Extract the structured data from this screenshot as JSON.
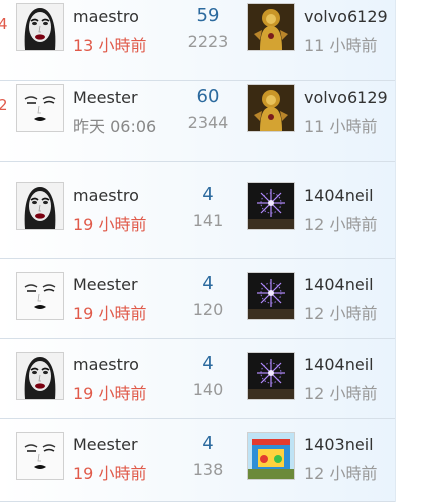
{
  "rows": [
    {
      "left_mark": "4",
      "author": "maestro",
      "author_time": "13 小時前",
      "author_time_color": "#e05a4a",
      "replies": "59",
      "views": "2223",
      "last_user": "volvo6129",
      "last_time": "11 小時前",
      "avatar_icon": "woman-face-icon",
      "thumb_icon": "golden-buddha-icon"
    },
    {
      "left_mark": "2",
      "author": "Meester",
      "author_time": "昨天 06:06",
      "author_time_color": "#888888",
      "replies": "60",
      "views": "2344",
      "last_user": "volvo6129",
      "last_time": "11 小時前",
      "avatar_icon": "sketch-face-icon",
      "thumb_icon": "golden-buddha-icon"
    },
    {
      "left_mark": "",
      "author": "maestro",
      "author_time": "19 小時前",
      "author_time_color": "#e05a4a",
      "replies": "4",
      "views": "141",
      "last_user": "1404neil",
      "last_time": "12 小時前",
      "avatar_icon": "woman-face-icon",
      "thumb_icon": "fireworks-icon"
    },
    {
      "left_mark": "",
      "author": "Meester",
      "author_time": "19 小時前",
      "author_time_color": "#e05a4a",
      "replies": "4",
      "views": "120",
      "last_user": "1404neil",
      "last_time": "12 小時前",
      "avatar_icon": "sketch-face-icon",
      "thumb_icon": "fireworks-icon"
    },
    {
      "left_mark": "",
      "author": "maestro",
      "author_time": "19 小時前",
      "author_time_color": "#e05a4a",
      "replies": "4",
      "views": "140",
      "last_user": "1404neil",
      "last_time": "12 小時前",
      "avatar_icon": "woman-face-icon",
      "thumb_icon": "fireworks-icon"
    },
    {
      "left_mark": "",
      "author": "Meester",
      "author_time": "19 小時前",
      "author_time_color": "#e05a4a",
      "replies": "4",
      "views": "138",
      "last_user": "1403neil",
      "last_time": "12 小時前",
      "avatar_icon": "sketch-face-icon",
      "thumb_icon": "bounce-house-icon"
    }
  ]
}
